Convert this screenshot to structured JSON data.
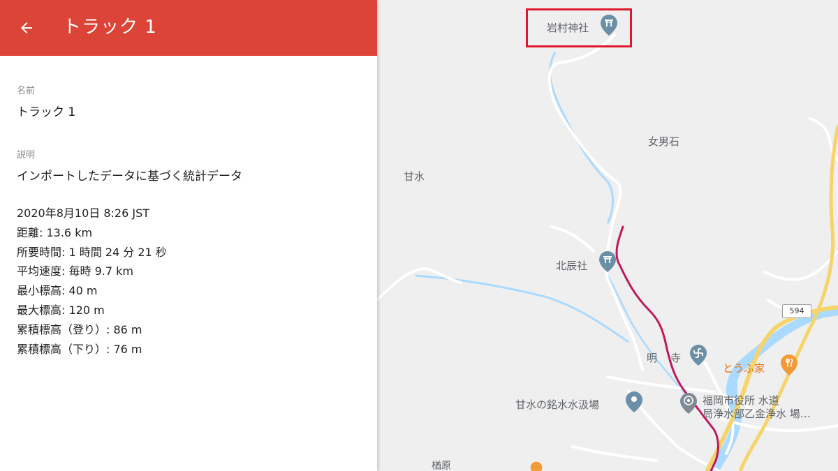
{
  "header": {
    "title": "トラック 1",
    "back_icon": "arrow-back-icon",
    "color": "#db4437"
  },
  "details": {
    "name_label": "名前",
    "name_value": "トラック 1",
    "description_label": "説明",
    "description_value": "インポートしたデータに基づく統計データ",
    "stats": [
      "2020年8月10日 8:26 JST",
      "距離: 13.6 km",
      "所要時間: 1 時間 24 分 21 秒",
      "平均速度: 毎時 9.7 km",
      "最小標高: 40 m",
      "最大標高: 120 m",
      "累積標高（登り）: 86 m",
      "累積標高（下り）: 76 m"
    ]
  },
  "map": {
    "track_color": "#c2185b",
    "water_color": "#aadaff",
    "highway_color": "#f6d46b",
    "labels": {
      "iwamura_shrine": "岩村神社",
      "meotoishi": "女男石",
      "amamizu": "甘水",
      "hokushinsha": "北辰社",
      "myoenji_a": "明",
      "myoenji_b": "寺",
      "tofuya": "とうふ家",
      "amamizu_spring": "甘水の銘水水汲場",
      "fukuoka_water_line1": "福岡市役所 水道",
      "fukuoka_water_line2": "局浄水部乙金浄水 場…",
      "yakihara": "楢原",
      "route_number": "594"
    },
    "icons": {
      "shrine": "shrine-torii-icon",
      "temple": "temple-manji-icon",
      "restaurant": "restaurant-icon",
      "place": "place-pin-icon",
      "government": "government-target-icon"
    }
  }
}
